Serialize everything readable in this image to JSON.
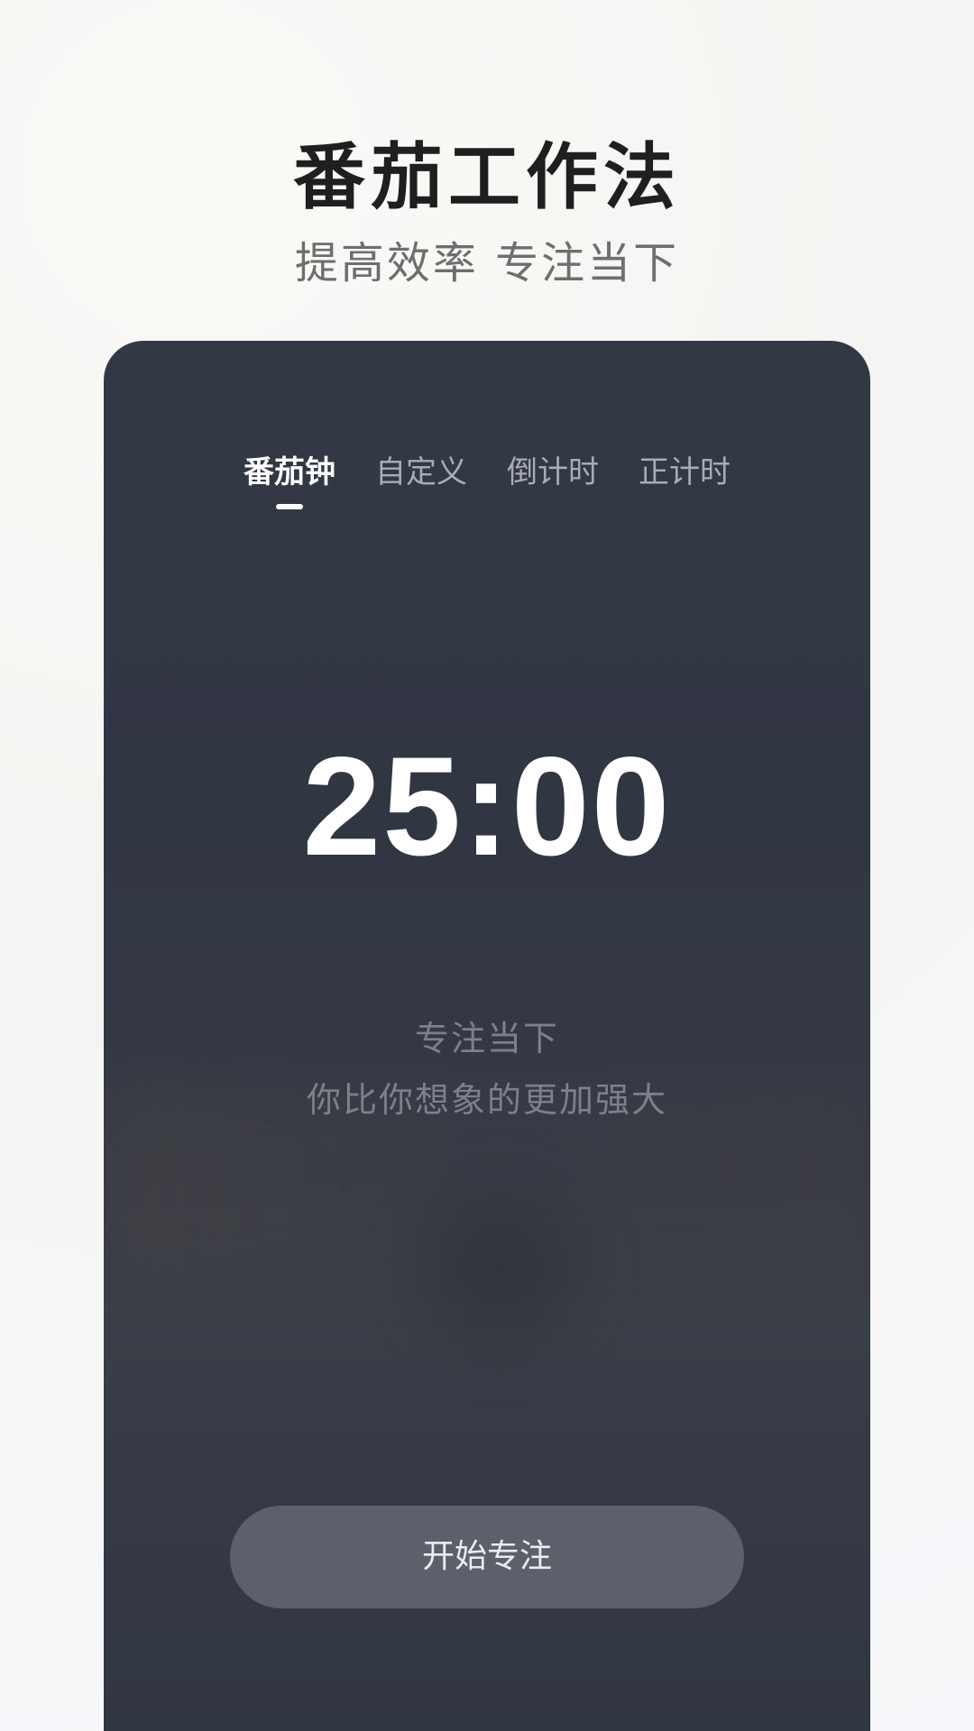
{
  "header": {
    "title": "番茄工作法",
    "subtitle": "提高效率  专注当下"
  },
  "tabs": [
    {
      "label": "番茄钟",
      "active": true
    },
    {
      "label": "自定义",
      "active": false
    },
    {
      "label": "倒计时",
      "active": false
    },
    {
      "label": "正计时",
      "active": false
    }
  ],
  "timer": {
    "display": "25:00"
  },
  "quote": {
    "line1": "专注当下",
    "line2": "你比你想象的更加强大"
  },
  "actions": {
    "start_label": "开始专注"
  },
  "colors": {
    "card_background": "#333845",
    "button_background": "#5c606b",
    "title_text": "#1f1f1f",
    "subtitle_text": "#6e6e6e"
  }
}
